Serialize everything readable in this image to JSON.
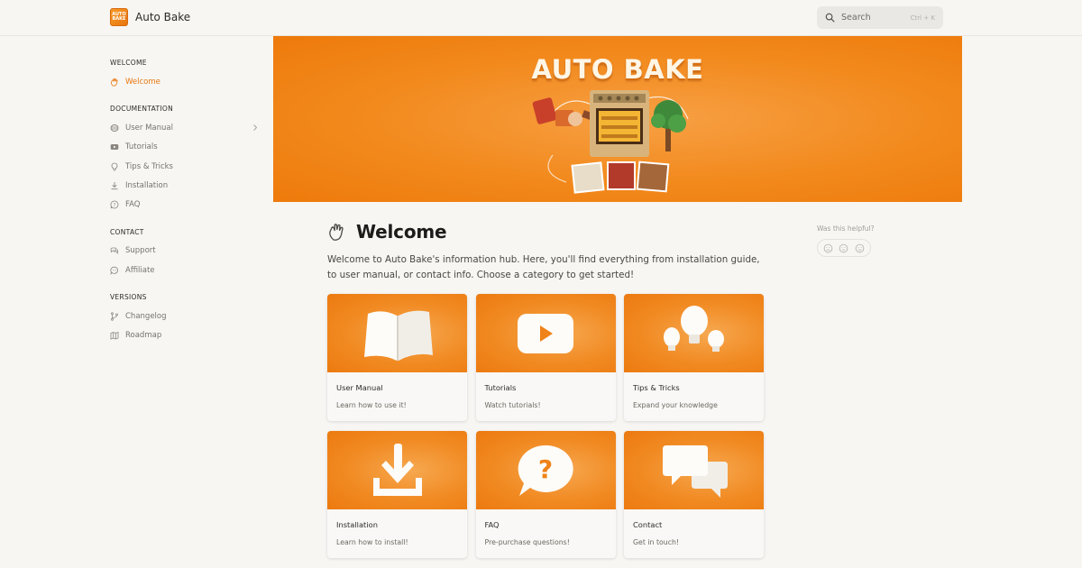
{
  "header": {
    "brand_name": "Auto Bake",
    "logo_text": "AUTO BAKE",
    "search": {
      "label": "Search",
      "shortcut": "Ctrl + K"
    }
  },
  "sidebar": {
    "sections": [
      {
        "heading": "WELCOME",
        "items": [
          {
            "label": "Welcome",
            "icon": "waving-hand-icon",
            "active": true
          }
        ]
      },
      {
        "heading": "DOCUMENTATION",
        "items": [
          {
            "label": "User Manual",
            "icon": "book-icon",
            "has_children": true
          },
          {
            "label": "Tutorials",
            "icon": "youtube-icon"
          },
          {
            "label": "Tips & Tricks",
            "icon": "lightbulb-icon"
          },
          {
            "label": "Installation",
            "icon": "download-icon"
          },
          {
            "label": "FAQ",
            "icon": "question-bubble-icon"
          }
        ]
      },
      {
        "heading": "CONTACT",
        "items": [
          {
            "label": "Support",
            "icon": "support-icon"
          },
          {
            "label": "Affiliate",
            "icon": "chat-icon"
          }
        ]
      },
      {
        "heading": "VERSIONS",
        "items": [
          {
            "label": "Changelog",
            "icon": "git-branch-icon"
          },
          {
            "label": "Roadmap",
            "icon": "map-icon"
          }
        ]
      }
    ]
  },
  "banner": {
    "title": "AUTO BAKE"
  },
  "main": {
    "title": "Welcome",
    "intro": "Welcome to Auto Bake's information hub. Here, you'll find everything from installation guide, to user manual, or contact info. Choose a category to get started!",
    "cards": [
      {
        "title": "User Manual",
        "description": "Learn how to use it!",
        "icon": "open-book-icon"
      },
      {
        "title": "Tutorials",
        "description": "Watch tutorials!",
        "icon": "play-button-icon"
      },
      {
        "title": "Tips & Tricks",
        "description": "Expand your knowledge",
        "icon": "lightbulbs-icon"
      },
      {
        "title": "Installation",
        "description": "Learn how to install!",
        "icon": "download-arrow-icon"
      },
      {
        "title": "FAQ",
        "description": "Pre-purchase questions!",
        "icon": "question-bubble-icon"
      },
      {
        "title": "Contact",
        "description": "Get in touch!",
        "icon": "chat-bubbles-icon"
      }
    ]
  },
  "feedback": {
    "label": "Was this helpful?",
    "options": [
      "sad-face-icon",
      "neutral-face-icon",
      "happy-face-icon"
    ]
  },
  "colors": {
    "accent": "#e8770f",
    "banner": "#f2891c",
    "background": "#f7f6f3"
  }
}
